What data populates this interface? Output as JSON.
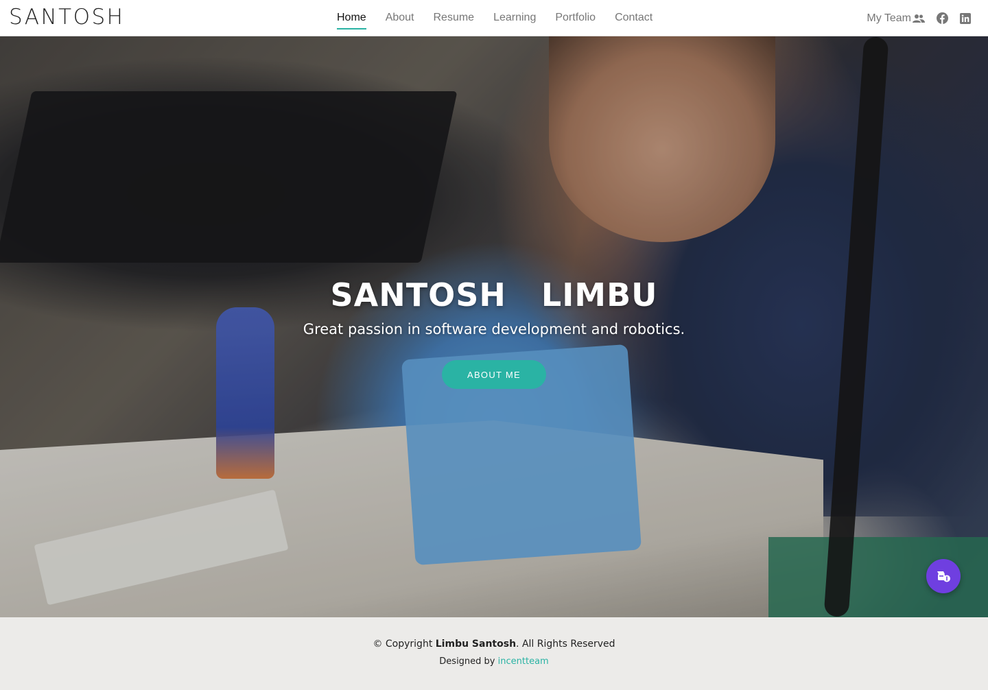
{
  "header": {
    "logo": "SANTOSH",
    "nav": [
      {
        "label": "Home",
        "active": true
      },
      {
        "label": "About"
      },
      {
        "label": "Resume"
      },
      {
        "label": "Learning"
      },
      {
        "label": "Portfolio"
      },
      {
        "label": "Contact"
      }
    ],
    "team_link": "My Team",
    "icons": [
      "users-icon",
      "facebook-icon",
      "linkedin-icon"
    ]
  },
  "hero": {
    "title": "SANTOSH   LIMBU",
    "subtitle": "Great passion in software development and robotics.",
    "button": "ABOUT ME",
    "background_image": "robotics workbench photo",
    "float_button_icon": "donate-icon"
  },
  "footer": {
    "copyright_prefix": "© Copyright ",
    "copyright_name": "Limbu Santosh",
    "copyright_suffix": ". All Rights Reserved",
    "designed_by": "Designed by ",
    "designer": "incentteam"
  },
  "colors": {
    "accent": "#2ab3a4",
    "float_button": "#6f3fe0",
    "footer_bg": "#ecebe9"
  }
}
